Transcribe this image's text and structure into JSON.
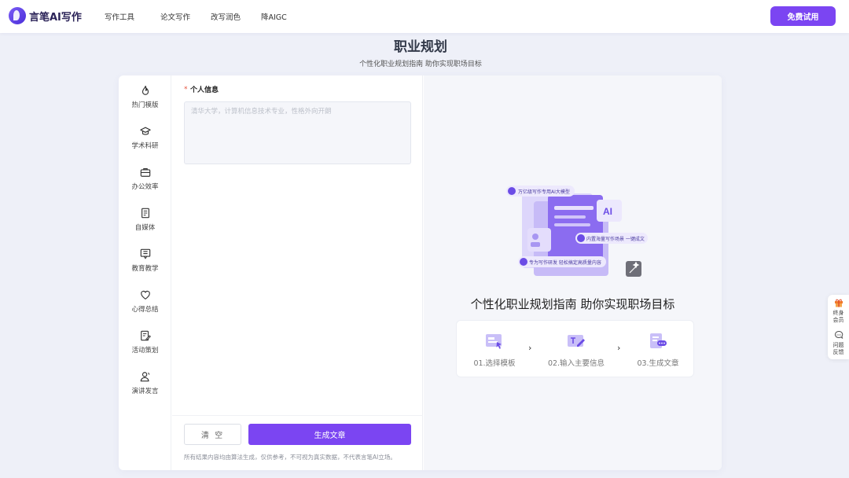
{
  "header": {
    "logo_text": "言笔AI写作",
    "nav": [
      "写作工具",
      "论文写作",
      "改写润色",
      "降AIGC"
    ],
    "trial_button": "免费试用"
  },
  "page": {
    "title": "职业规划",
    "subtitle": "个性化职业规划指南 助你实现职场目标"
  },
  "sidebar": {
    "items": [
      {
        "label": "热门模版",
        "icon": "flame-icon"
      },
      {
        "label": "学术科研",
        "icon": "graduation-cap-icon"
      },
      {
        "label": "办公效率",
        "icon": "briefcase-icon"
      },
      {
        "label": "自媒体",
        "icon": "document-icon"
      },
      {
        "label": "教育教学",
        "icon": "chat-board-icon"
      },
      {
        "label": "心得总结",
        "icon": "heart-icon"
      },
      {
        "label": "活动策划",
        "icon": "edit-note-icon"
      },
      {
        "label": "演讲发言",
        "icon": "speaker-icon"
      }
    ]
  },
  "form": {
    "field_label": "个人信息",
    "required_mark": "*",
    "placeholder": "清华大学，计算机信息技术专业，性格外向开朗",
    "clear_button": "清 空",
    "generate_button": "生成文章",
    "disclaimer": "所有结果内容均由算法生成，仅供参考，不可视为真实数据，不代表言笔AI立场。"
  },
  "preview": {
    "illustration_tags": [
      "万亿级写作专用AI大模型",
      "内置海量写作场景 一键成文",
      "专为写作研发 轻松搞定高质量内容"
    ],
    "illustration_badge": "AI",
    "title": "个性化职业规划指南 助你实现职场目标",
    "steps": [
      "01.选择模板",
      "02.输入主要信息",
      "03.生成文章"
    ],
    "arrow": "›"
  },
  "float_panel": {
    "member": "终身\n会员",
    "feedback": "问题\n反馈"
  },
  "colors": {
    "accent": "#7b45f2",
    "background": "#eef0f8"
  }
}
